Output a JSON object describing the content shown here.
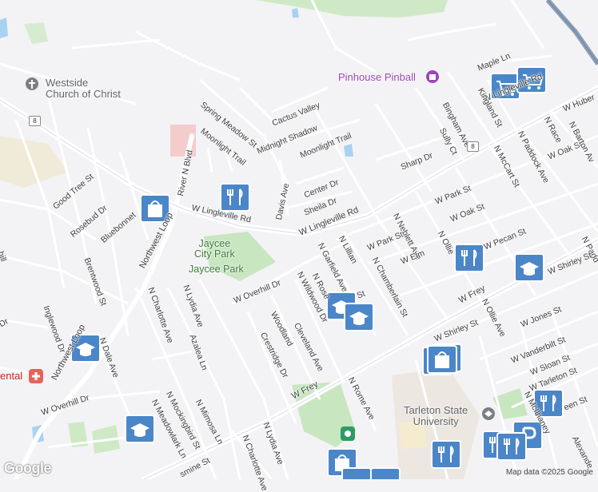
{
  "streets": {
    "w_lingleville_rd_1": "W Lingleville Rd",
    "w_lingleville_rd_2": "W Lingleville Rd",
    "w_lingleville_rd_3": "W Lingleville Rd",
    "maple_ln": "Maple Ln",
    "kingland_st": "Kingland St",
    "bingham_ave": "Bingham Ave",
    "sully_ct": "Sully Ct",
    "cactus_valley": "Cactus Valley",
    "spring_meadow_st": "Spring Meadow St",
    "midnight_shadow": "Midnight Shadow",
    "moonlight_trail_1": "Moonlight Trail",
    "moonlight_trail_2": "Moonlight Trail",
    "river_n_blvd": "River N Blvd",
    "good_tree_st": "Good Tree St",
    "rosebud_dr": "Rosebud Dr",
    "bluebonnet": "Bluebonnet",
    "davis_ave": "Davis Ave",
    "center_dr": "Center Dr",
    "sheila_dr": "Sheila Dr",
    "sharp_dr": "Sharp Dr",
    "w_park_st_1": "W Park St",
    "w_park_st_2": "W Park St",
    "w_oak_st_1": "W Oak St",
    "w_oak_st_2": "W Oak St",
    "n_neblett_ave": "N Neblett Ave",
    "n_lillian": "N Lillian",
    "n_garfield_ave": "N Garfield Ave",
    "n_chamberlain_st": "N Chamberlain St",
    "w_elm": "W Elm",
    "n_ollie": "N Ollie",
    "w_pecan_st": "W Pecan St",
    "n_ollie_ave": "N Ollie Ave",
    "n_mccart_st": "N McCart St",
    "n_race": "N Race",
    "n_paddock_ave": "N Paddock Ave",
    "w_huber": "W Huber",
    "n_barton_av": "N Barton Av",
    "n_paddock": "N Padd",
    "northwest_loop_1": "Northwest Loop",
    "northwest_loop_2": "Northwest Loop",
    "brentwood_st": "Brentwood St",
    "inglewood": "Inglewood Dr",
    "n_dale_ave": "N Dale Ave",
    "n_charlotte_ave_1": "N Charlotte Ave",
    "n_charlotte_ave_2": "N Charlotte Ave",
    "n_lydia_ave_1": "N Lydia Ave",
    "n_lydia_ave_2": "N Lydia Ave",
    "azalea_ln": "Azalea Ln",
    "w_overhill_dr_1": "W Overhill Dr",
    "w_overhill_dr_2": "W Overhill Dr",
    "woodland": "Woodland",
    "n_wildwood_dr": "N Wildwood Dr",
    "crestridge_dr": "Crestridge Dr",
    "cleveland_ave": "Cleveland Ave",
    "n_rose": "N Rose",
    "w_frey_1": "W Frey",
    "w_frey_2": "W Frey",
    "w_shirley_st_1": "W Shirley St",
    "w_shirley_st_2": "W Shirley St",
    "w_jones_st": "W Jones St",
    "w_vanderbilt_st": "W Vanderbilt St",
    "w_sloan_st": "W Sloan St",
    "w_tarleton_st": "W Tarleton St",
    "n_mcilhaney": "N McIlhaney",
    "n_rome_ave": "N Rome Ave",
    "n_mockingbird_st": "N Mockingbird St",
    "n_meadowlark_ln": "N Meadowlark Ln",
    "n_mimosa_ln": "N Mimosa Ln",
    "jasmine_st": "smine St",
    "alexander": "Alexande",
    "green_st": "een St",
    "st_end": "St",
    "dr_left": "Dr",
    "hill_left": "hill"
  },
  "pois": {
    "westside_church": "Westside\nChurch of Christ",
    "pinhouse_pinball": "Pinhouse Pinball",
    "jaycee_city_park": "Jaycee\nCity Park",
    "jaycee_park": "Jaycee Park",
    "tarleton_state": "Tarleton State\nUniversity",
    "dental": "ental"
  },
  "route_shields": {
    "route_8_left": "8",
    "route_8_right": "8"
  },
  "footer": {
    "google_logo": "Google",
    "map_data": "Map data ©2025 Google"
  },
  "colors": {
    "park_green": "#c8e6c0",
    "poi_blue": "#4b86c8",
    "poi_purple": "#9c47b5",
    "highway": "#8a9fb5",
    "water": "#a9d1f0"
  }
}
